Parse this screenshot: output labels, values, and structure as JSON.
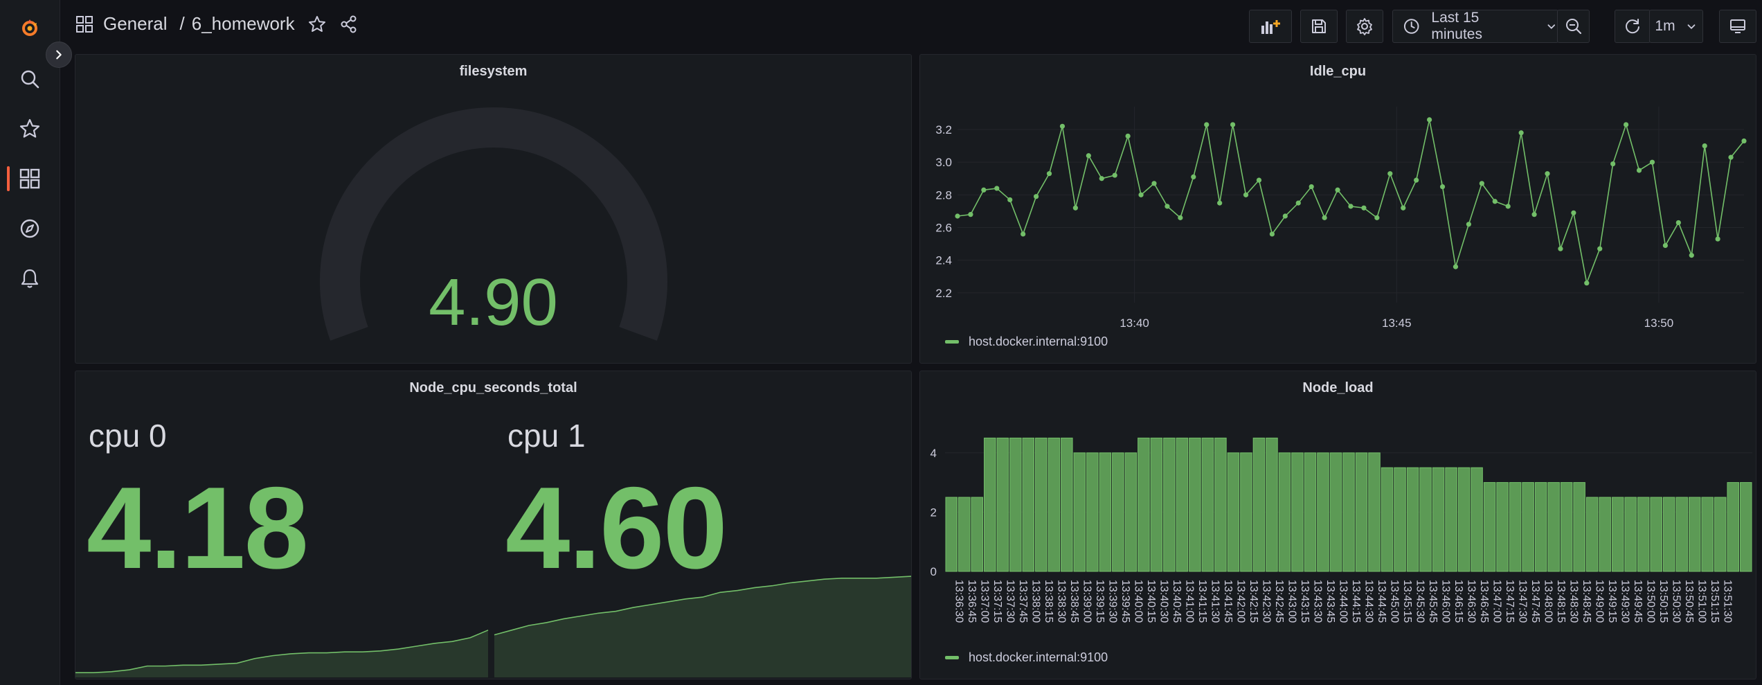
{
  "breadcrumb": {
    "folder": "General",
    "separator": "/",
    "dashboard": "6_homework"
  },
  "toolbar": {
    "time_range": "Last 15 minutes",
    "refresh_interval": "1m"
  },
  "colors": {
    "accent": "#73bf69",
    "brand": "#f55f3e",
    "background": "#111217",
    "panel": "#181b1f"
  },
  "icons": {
    "sidebar": [
      "grafana-logo-icon",
      "search-icon",
      "star-icon",
      "dashboards-icon",
      "explore-icon",
      "alerting-icon"
    ],
    "toolbar": [
      "add-panel-icon",
      "save-icon",
      "settings-icon",
      "clock-icon",
      "chevron-down-icon",
      "zoom-out-icon",
      "refresh-icon",
      "chevron-down-icon",
      "tv-mode-icon"
    ]
  },
  "panels": {
    "filesystem": {
      "title": "filesystem",
      "value": "4.90",
      "fill_fraction": 0.0
    },
    "idle_cpu": {
      "title": "Idle_cpu",
      "legend": "host.docker.internal:9100"
    },
    "node_cpu": {
      "title": "Node_cpu_seconds_total",
      "stats": [
        {
          "label": "cpu 0",
          "value": "4.18"
        },
        {
          "label": "cpu 1",
          "value": "4.60"
        }
      ]
    },
    "node_load": {
      "title": "Node_load",
      "legend": "host.docker.internal:9100"
    }
  },
  "chart_data": [
    {
      "type": "line",
      "title": "Idle_cpu",
      "series": [
        {
          "name": "host.docker.internal:9100",
          "values": [
            2.67,
            2.68,
            2.83,
            2.84,
            2.77,
            2.56,
            2.79,
            2.93,
            3.22,
            2.72,
            3.04,
            2.9,
            2.92,
            3.16,
            2.8,
            2.87,
            2.73,
            2.66,
            2.91,
            3.23,
            2.75,
            3.23,
            2.8,
            2.89,
            2.56,
            2.67,
            2.75,
            2.85,
            2.66,
            2.83,
            2.73,
            2.72,
            2.66,
            2.93,
            2.72,
            2.89,
            3.26,
            2.85,
            2.36,
            2.62,
            2.87,
            2.76,
            2.73,
            3.18,
            2.68,
            2.93,
            2.47,
            2.69,
            2.26,
            2.47,
            2.99,
            3.23,
            2.95,
            3.0,
            2.49,
            2.63,
            2.43,
            3.1,
            2.53,
            3.03,
            3.13
          ]
        }
      ],
      "x_ticks": [
        "13:40",
        "13:45",
        "13:50"
      ],
      "x_tick_index": [
        13.5,
        33.5,
        53.5
      ],
      "y_ticks": [
        "2.2",
        "2.4",
        "2.6",
        "2.8",
        "3.0",
        "3.2"
      ],
      "ylim": [
        2.14,
        3.34
      ],
      "grid": true,
      "legend_position": "bottom-left"
    },
    {
      "type": "bar",
      "title": "Node_load",
      "categories": [
        "13:36:30",
        "13:36:45",
        "13:37:00",
        "13:37:15",
        "13:37:30",
        "13:37:45",
        "13:38:00",
        "13:38:15",
        "13:38:30",
        "13:38:45",
        "13:39:00",
        "13:39:15",
        "13:39:30",
        "13:39:45",
        "13:40:00",
        "13:40:15",
        "13:40:30",
        "13:40:45",
        "13:41:00",
        "13:41:15",
        "13:41:30",
        "13:41:45",
        "13:42:00",
        "13:42:15",
        "13:42:30",
        "13:42:45",
        "13:43:00",
        "13:43:15",
        "13:43:30",
        "13:43:45",
        "13:44:00",
        "13:44:15",
        "13:44:30",
        "13:44:45",
        "13:45:00",
        "13:45:15",
        "13:45:30",
        "13:45:45",
        "13:46:00",
        "13:46:15",
        "13:46:30",
        "13:46:45",
        "13:47:00",
        "13:47:15",
        "13:47:30",
        "13:47:45",
        "13:48:00",
        "13:48:15",
        "13:48:30",
        "13:48:45",
        "13:49:00",
        "13:49:15",
        "13:49:30",
        "13:49:45",
        "13:50:00",
        "13:50:15",
        "13:50:30",
        "13:50:45",
        "13:51:00",
        "13:51:15",
        "13:51:30"
      ],
      "series": [
        {
          "name": "host.docker.internal:9100",
          "values": [
            2.5,
            2.5,
            2.5,
            4.5,
            4.5,
            4.5,
            4.5,
            4.5,
            4.5,
            4.5,
            4,
            4,
            4,
            4,
            4,
            4.5,
            4.5,
            4.5,
            4.5,
            4.5,
            4.5,
            4.5,
            4,
            4,
            4.5,
            4.5,
            4,
            4,
            4,
            4,
            4,
            4,
            4,
            4,
            3.5,
            3.5,
            3.5,
            3.5,
            3.5,
            3.5,
            3.5,
            3.5,
            3,
            3,
            3,
            3,
            3,
            3,
            3,
            3,
            2.5,
            2.5,
            2.5,
            2.5,
            2.5,
            2.5,
            2.5,
            2.5,
            2.5,
            2.5,
            2.5,
            3,
            3
          ]
        }
      ],
      "y_ticks": [
        "0",
        "2",
        "4"
      ],
      "ylim": [
        0,
        5
      ],
      "grid": true,
      "legend_position": "bottom-left"
    },
    {
      "type": "area",
      "title": "cpu 0 sparkline",
      "values": [
        0.05,
        0.05,
        0.06,
        0.08,
        0.12,
        0.12,
        0.13,
        0.13,
        0.14,
        0.15,
        0.2,
        0.23,
        0.25,
        0.26,
        0.26,
        0.27,
        0.27,
        0.28,
        0.3,
        0.33,
        0.36,
        0.38,
        0.42,
        0.5
      ]
    },
    {
      "type": "area",
      "title": "cpu 1 sparkline",
      "values": [
        0.45,
        0.5,
        0.55,
        0.58,
        0.62,
        0.65,
        0.68,
        0.7,
        0.74,
        0.77,
        0.8,
        0.83,
        0.85,
        0.9,
        0.92,
        0.95,
        0.97,
        1.0,
        1.02,
        1.04,
        1.05,
        1.05,
        1.05,
        1.06,
        1.07
      ]
    }
  ]
}
